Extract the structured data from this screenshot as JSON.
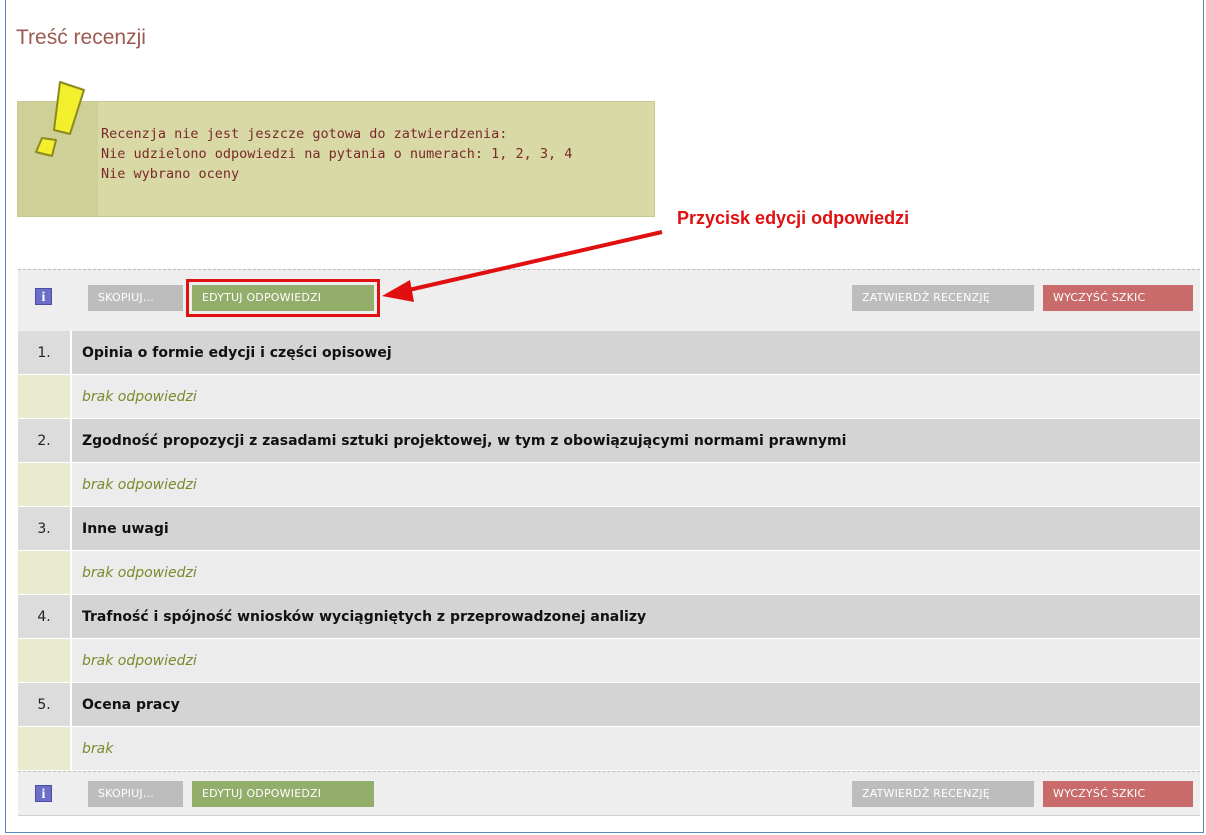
{
  "page": {
    "title": "Treść recenzji"
  },
  "alert": {
    "lines": [
      "Recenzja nie jest jeszcze gotowa do zatwierdzenia:",
      "Nie udzielono odpowiedzi na pytania o numerach: 1, 2, 3, 4",
      "Nie wybrano oceny"
    ],
    "icon": "exclamation-icon"
  },
  "annotation": {
    "label": "Przycisk edycji odpowiedzi"
  },
  "toolbar": {
    "info_icon_glyph": "i",
    "copy_label": "SKOPIUJ...",
    "edit_label": "EDYTUJ ODPOWIEDZI",
    "approve_label": "ZATWIERDŹ RECENZJĘ",
    "clear_label": "WYCZYŚĆ SZKIC"
  },
  "questions": [
    {
      "number": "1.",
      "title": "Opinia o formie edycji i części opisowej",
      "answer": "brak odpowiedzi"
    },
    {
      "number": "2.",
      "title": "Zgodność propozycji z zasadami sztuki projektowej, w tym z obowiązującymi normami prawnymi",
      "answer": "brak odpowiedzi"
    },
    {
      "number": "3.",
      "title": "Inne uwagi",
      "answer": "brak odpowiedzi"
    },
    {
      "number": "4.",
      "title": "Trafność i spójność wniosków wyciągniętych z przeprowadzonej analizy",
      "answer": "brak odpowiedzi"
    },
    {
      "number": "5.",
      "title": "Ocena pracy",
      "answer": "brak"
    }
  ],
  "colors": {
    "title": "#9b5b52",
    "alert_bg": "#d9d9a6",
    "alert_text": "#7a2a2a",
    "annotation": "#e01010",
    "edit_button": "#93ad6b",
    "clear_button": "#c96b6b",
    "disabled_button": "#bdbdbd"
  }
}
